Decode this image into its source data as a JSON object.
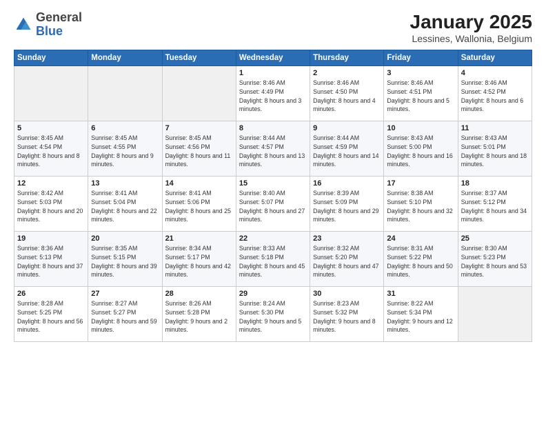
{
  "logo": {
    "general": "General",
    "blue": "Blue"
  },
  "header": {
    "title": "January 2025",
    "subtitle": "Lessines, Wallonia, Belgium"
  },
  "weekdays": [
    "Sunday",
    "Monday",
    "Tuesday",
    "Wednesday",
    "Thursday",
    "Friday",
    "Saturday"
  ],
  "weeks": [
    [
      {
        "day": "",
        "sunrise": "",
        "sunset": "",
        "daylight": ""
      },
      {
        "day": "",
        "sunrise": "",
        "sunset": "",
        "daylight": ""
      },
      {
        "day": "",
        "sunrise": "",
        "sunset": "",
        "daylight": ""
      },
      {
        "day": "1",
        "sunrise": "Sunrise: 8:46 AM",
        "sunset": "Sunset: 4:49 PM",
        "daylight": "Daylight: 8 hours and 3 minutes."
      },
      {
        "day": "2",
        "sunrise": "Sunrise: 8:46 AM",
        "sunset": "Sunset: 4:50 PM",
        "daylight": "Daylight: 8 hours and 4 minutes."
      },
      {
        "day": "3",
        "sunrise": "Sunrise: 8:46 AM",
        "sunset": "Sunset: 4:51 PM",
        "daylight": "Daylight: 8 hours and 5 minutes."
      },
      {
        "day": "4",
        "sunrise": "Sunrise: 8:46 AM",
        "sunset": "Sunset: 4:52 PM",
        "daylight": "Daylight: 8 hours and 6 minutes."
      }
    ],
    [
      {
        "day": "5",
        "sunrise": "Sunrise: 8:45 AM",
        "sunset": "Sunset: 4:54 PM",
        "daylight": "Daylight: 8 hours and 8 minutes."
      },
      {
        "day": "6",
        "sunrise": "Sunrise: 8:45 AM",
        "sunset": "Sunset: 4:55 PM",
        "daylight": "Daylight: 8 hours and 9 minutes."
      },
      {
        "day": "7",
        "sunrise": "Sunrise: 8:45 AM",
        "sunset": "Sunset: 4:56 PM",
        "daylight": "Daylight: 8 hours and 11 minutes."
      },
      {
        "day": "8",
        "sunrise": "Sunrise: 8:44 AM",
        "sunset": "Sunset: 4:57 PM",
        "daylight": "Daylight: 8 hours and 13 minutes."
      },
      {
        "day": "9",
        "sunrise": "Sunrise: 8:44 AM",
        "sunset": "Sunset: 4:59 PM",
        "daylight": "Daylight: 8 hours and 14 minutes."
      },
      {
        "day": "10",
        "sunrise": "Sunrise: 8:43 AM",
        "sunset": "Sunset: 5:00 PM",
        "daylight": "Daylight: 8 hours and 16 minutes."
      },
      {
        "day": "11",
        "sunrise": "Sunrise: 8:43 AM",
        "sunset": "Sunset: 5:01 PM",
        "daylight": "Daylight: 8 hours and 18 minutes."
      }
    ],
    [
      {
        "day": "12",
        "sunrise": "Sunrise: 8:42 AM",
        "sunset": "Sunset: 5:03 PM",
        "daylight": "Daylight: 8 hours and 20 minutes."
      },
      {
        "day": "13",
        "sunrise": "Sunrise: 8:41 AM",
        "sunset": "Sunset: 5:04 PM",
        "daylight": "Daylight: 8 hours and 22 minutes."
      },
      {
        "day": "14",
        "sunrise": "Sunrise: 8:41 AM",
        "sunset": "Sunset: 5:06 PM",
        "daylight": "Daylight: 8 hours and 25 minutes."
      },
      {
        "day": "15",
        "sunrise": "Sunrise: 8:40 AM",
        "sunset": "Sunset: 5:07 PM",
        "daylight": "Daylight: 8 hours and 27 minutes."
      },
      {
        "day": "16",
        "sunrise": "Sunrise: 8:39 AM",
        "sunset": "Sunset: 5:09 PM",
        "daylight": "Daylight: 8 hours and 29 minutes."
      },
      {
        "day": "17",
        "sunrise": "Sunrise: 8:38 AM",
        "sunset": "Sunset: 5:10 PM",
        "daylight": "Daylight: 8 hours and 32 minutes."
      },
      {
        "day": "18",
        "sunrise": "Sunrise: 8:37 AM",
        "sunset": "Sunset: 5:12 PM",
        "daylight": "Daylight: 8 hours and 34 minutes."
      }
    ],
    [
      {
        "day": "19",
        "sunrise": "Sunrise: 8:36 AM",
        "sunset": "Sunset: 5:13 PM",
        "daylight": "Daylight: 8 hours and 37 minutes."
      },
      {
        "day": "20",
        "sunrise": "Sunrise: 8:35 AM",
        "sunset": "Sunset: 5:15 PM",
        "daylight": "Daylight: 8 hours and 39 minutes."
      },
      {
        "day": "21",
        "sunrise": "Sunrise: 8:34 AM",
        "sunset": "Sunset: 5:17 PM",
        "daylight": "Daylight: 8 hours and 42 minutes."
      },
      {
        "day": "22",
        "sunrise": "Sunrise: 8:33 AM",
        "sunset": "Sunset: 5:18 PM",
        "daylight": "Daylight: 8 hours and 45 minutes."
      },
      {
        "day": "23",
        "sunrise": "Sunrise: 8:32 AM",
        "sunset": "Sunset: 5:20 PM",
        "daylight": "Daylight: 8 hours and 47 minutes."
      },
      {
        "day": "24",
        "sunrise": "Sunrise: 8:31 AM",
        "sunset": "Sunset: 5:22 PM",
        "daylight": "Daylight: 8 hours and 50 minutes."
      },
      {
        "day": "25",
        "sunrise": "Sunrise: 8:30 AM",
        "sunset": "Sunset: 5:23 PM",
        "daylight": "Daylight: 8 hours and 53 minutes."
      }
    ],
    [
      {
        "day": "26",
        "sunrise": "Sunrise: 8:28 AM",
        "sunset": "Sunset: 5:25 PM",
        "daylight": "Daylight: 8 hours and 56 minutes."
      },
      {
        "day": "27",
        "sunrise": "Sunrise: 8:27 AM",
        "sunset": "Sunset: 5:27 PM",
        "daylight": "Daylight: 8 hours and 59 minutes."
      },
      {
        "day": "28",
        "sunrise": "Sunrise: 8:26 AM",
        "sunset": "Sunset: 5:28 PM",
        "daylight": "Daylight: 9 hours and 2 minutes."
      },
      {
        "day": "29",
        "sunrise": "Sunrise: 8:24 AM",
        "sunset": "Sunset: 5:30 PM",
        "daylight": "Daylight: 9 hours and 5 minutes."
      },
      {
        "day": "30",
        "sunrise": "Sunrise: 8:23 AM",
        "sunset": "Sunset: 5:32 PM",
        "daylight": "Daylight: 9 hours and 8 minutes."
      },
      {
        "day": "31",
        "sunrise": "Sunrise: 8:22 AM",
        "sunset": "Sunset: 5:34 PM",
        "daylight": "Daylight: 9 hours and 12 minutes."
      },
      {
        "day": "",
        "sunrise": "",
        "sunset": "",
        "daylight": ""
      }
    ]
  ]
}
